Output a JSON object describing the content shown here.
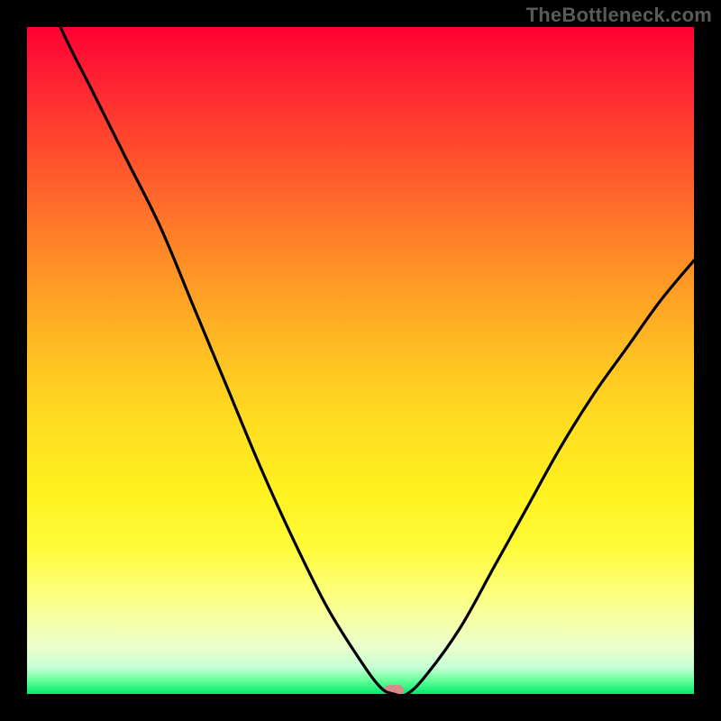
{
  "watermark": "TheBottleneck.com",
  "colors": {
    "background": "#000000",
    "curve": "#000000",
    "marker": "#d88a8a",
    "gradient_top": "#ff0033",
    "gradient_bottom": "#00e96b"
  },
  "chart_data": {
    "type": "line",
    "title": "",
    "xlabel": "",
    "ylabel": "",
    "xlim": [
      0,
      100
    ],
    "ylim": [
      0,
      100
    ],
    "grid": false,
    "series": [
      {
        "name": "bottleneck_curve",
        "x": [
          0,
          5,
          10,
          15,
          20,
          25,
          30,
          35,
          40,
          45,
          50,
          53,
          55,
          57,
          60,
          65,
          70,
          75,
          80,
          85,
          90,
          95,
          100
        ],
        "values": [
          112,
          100,
          90,
          80,
          70,
          58,
          46,
          34,
          23,
          13,
          5,
          1,
          0,
          0,
          3,
          10,
          19,
          28,
          37,
          45,
          52,
          59,
          65
        ]
      }
    ],
    "marker": {
      "x": 55,
      "y": 0,
      "label": ""
    }
  }
}
